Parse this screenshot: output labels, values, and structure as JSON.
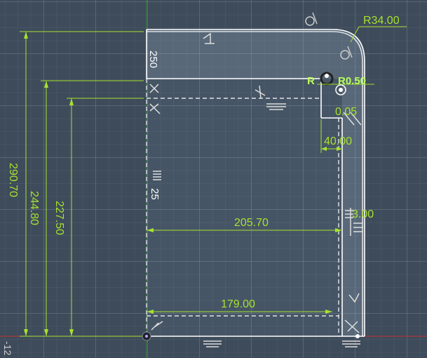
{
  "colors": {
    "background": "#3e4b5b",
    "sketch_line": "#ffffff",
    "dimension": "#a6e22e",
    "axis_x": "#c83030",
    "axis_y": "#3a8a3a",
    "highlight": "#9fdc2a"
  },
  "dimensions": {
    "radius_outer": "R34.00",
    "radius_inner": "R0.50",
    "radius_inner_prefix": "R",
    "small_dim": "0.05",
    "leg_width": "40.00",
    "total_height": "290.70",
    "inner_height": "244.80",
    "lower_height": "227.50",
    "width_upper": "205.70",
    "width_lower": "179.00",
    "thickness": "3.00"
  },
  "symbols": {
    "top_vertical": "250",
    "left_vertical": "25"
  },
  "axis": {
    "x_origin_label": "-12"
  }
}
